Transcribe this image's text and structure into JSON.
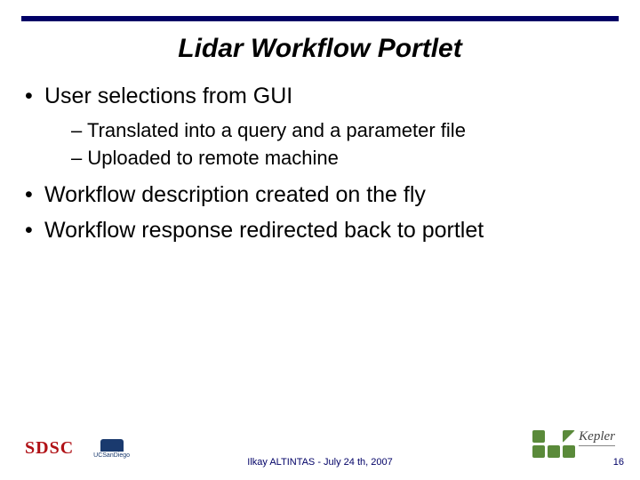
{
  "title": "Lidar Workflow Portlet",
  "bullets": {
    "b1": "User selections from GUI",
    "b1_sub1": "Translated into a query and a parameter file",
    "b1_sub2": "Uploaded to remote machine",
    "b2": "Workflow description created on the fly",
    "b3": "Workflow response redirected back to portlet"
  },
  "footer": {
    "author_line": "Ilkay ALTINTAS - July 24 th, 2007",
    "page_number": "16"
  },
  "logos": {
    "sdsc": "SDSC",
    "ucsd": "UCSanDiego",
    "kepler": "Kepler"
  }
}
